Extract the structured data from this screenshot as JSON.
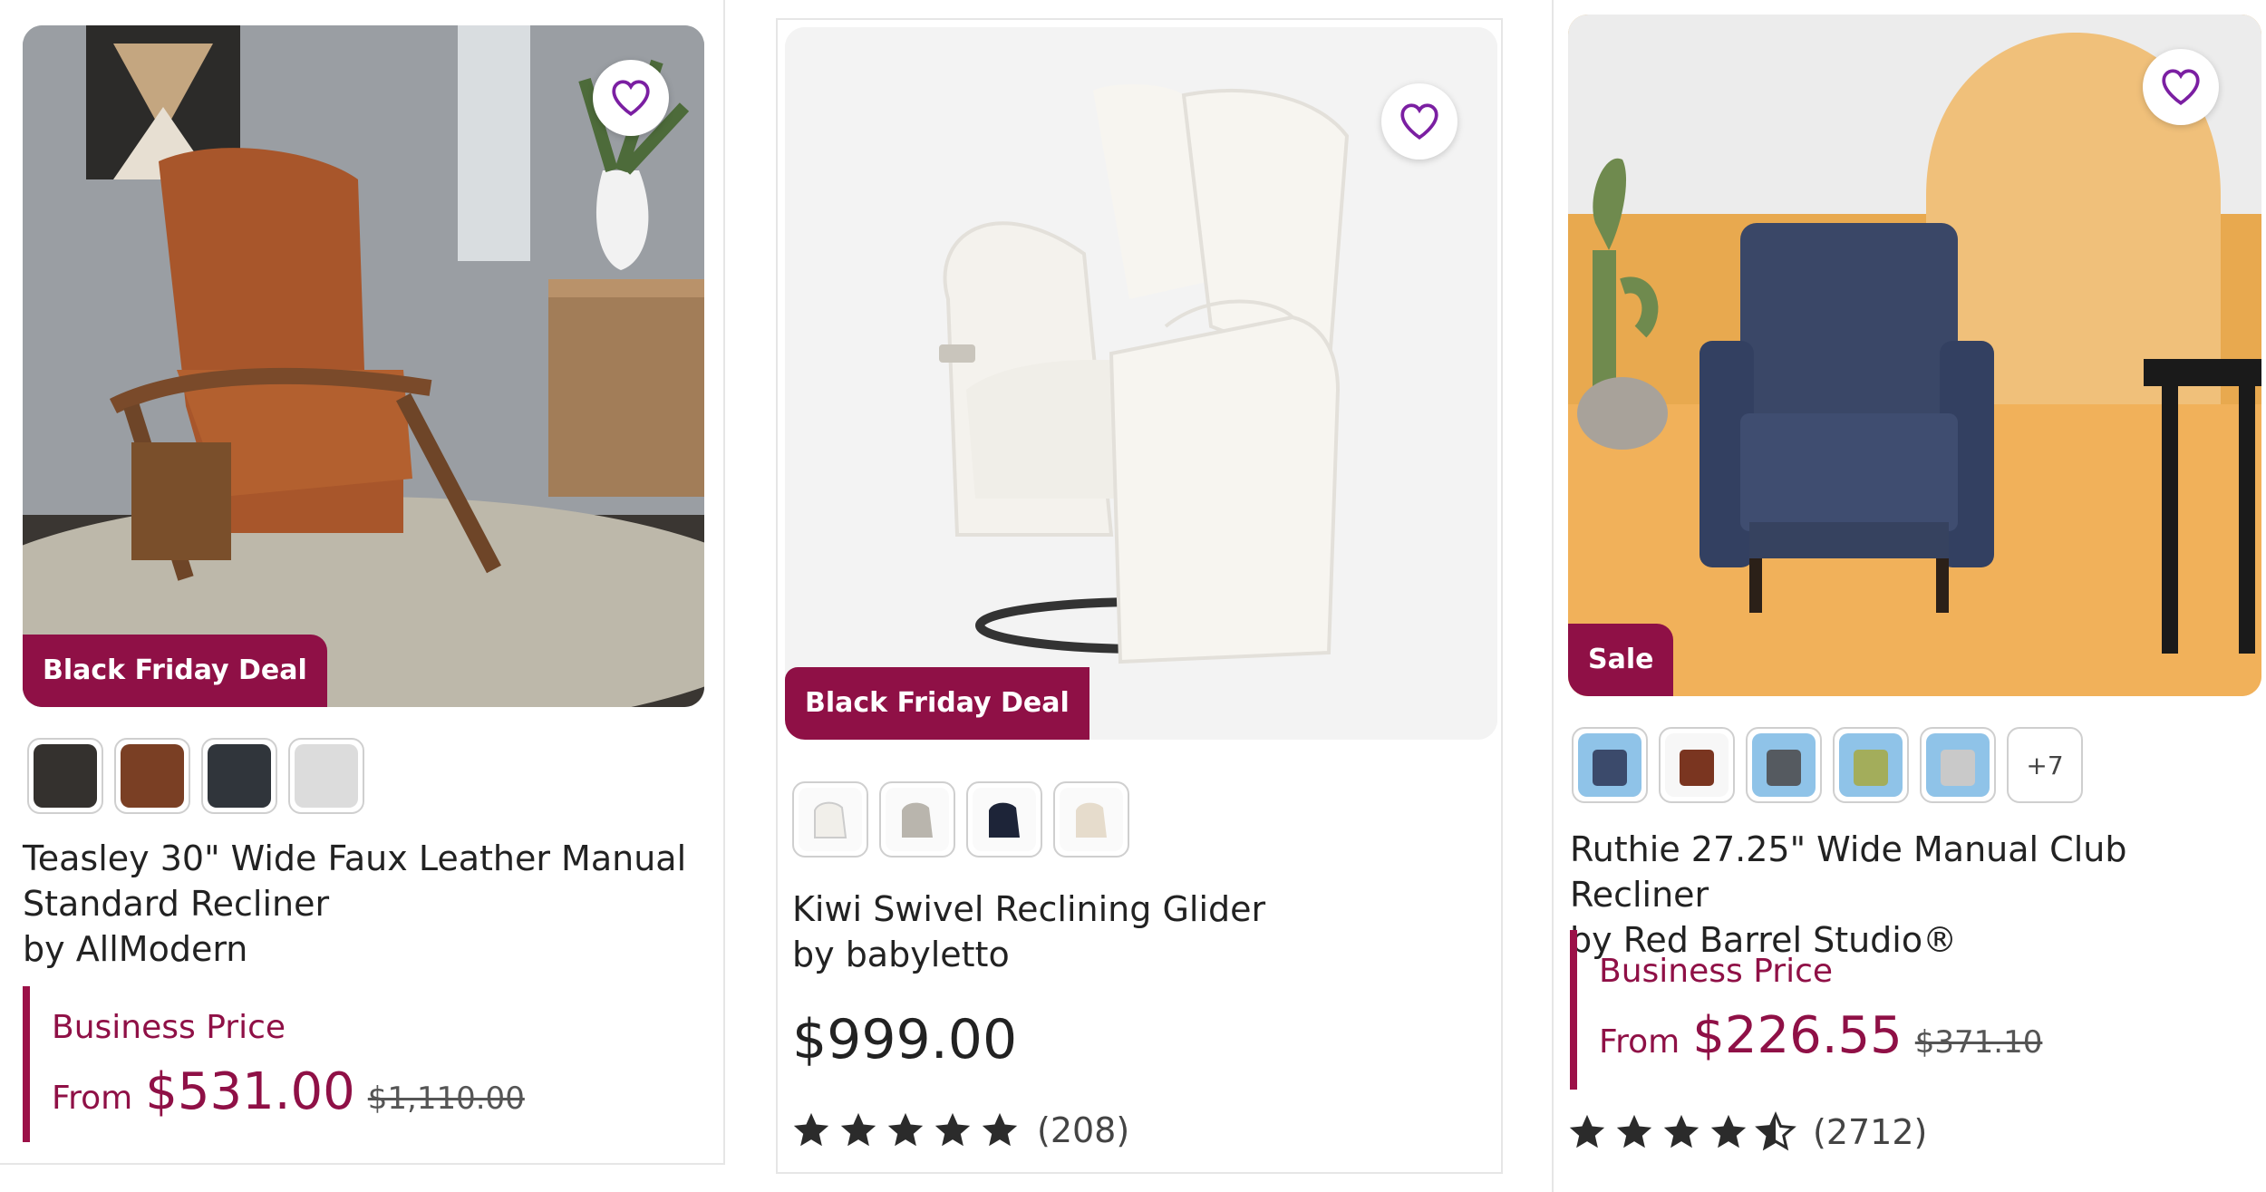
{
  "products": [
    {
      "badge": "Black Friday Deal",
      "title": "Teasley 30\" Wide Faux Leather Manual Standard Recliner",
      "byline": "by AllModern",
      "business_label": "Business Price",
      "from_label": "From",
      "price": "$531.00",
      "was_price": "$1,110.00",
      "swatches": [
        {
          "color": "#34312e"
        },
        {
          "color": "#7a3f24"
        },
        {
          "color": "#30353b"
        },
        {
          "color": "#dcdcdc"
        }
      ]
    },
    {
      "badge": "Black Friday Deal",
      "title": "Kiwi Swivel Reclining Glider",
      "byline": "by babyletto",
      "price": "$999.00",
      "rating": 5,
      "review_count": "(208)",
      "swatches": [
        {
          "color": "#f1efea"
        },
        {
          "color": "#b9b5ad"
        },
        {
          "color": "#1d2438"
        },
        {
          "color": "#e6dccc"
        }
      ]
    },
    {
      "badge": "Sale",
      "title": "Ruthie 27.25\" Wide Manual Club Recliner",
      "byline": "by Red Barrel Studio®",
      "business_label": "Business Price",
      "from_label": "From",
      "price": "$226.55",
      "was_price": "$371.10",
      "rating": 4.5,
      "review_count": "(2712)",
      "more_swatches": "+7",
      "swatches": [
        {
          "color": "#3b4a6b"
        },
        {
          "color": "#7a3520"
        },
        {
          "color": "#555a60"
        },
        {
          "color": "#a3ad5b"
        },
        {
          "color": "#c9c9c9"
        }
      ]
    }
  ],
  "colors": {
    "brand": "#8f1046",
    "star": "#2b2b2b",
    "heart": "#7b1fa2"
  }
}
